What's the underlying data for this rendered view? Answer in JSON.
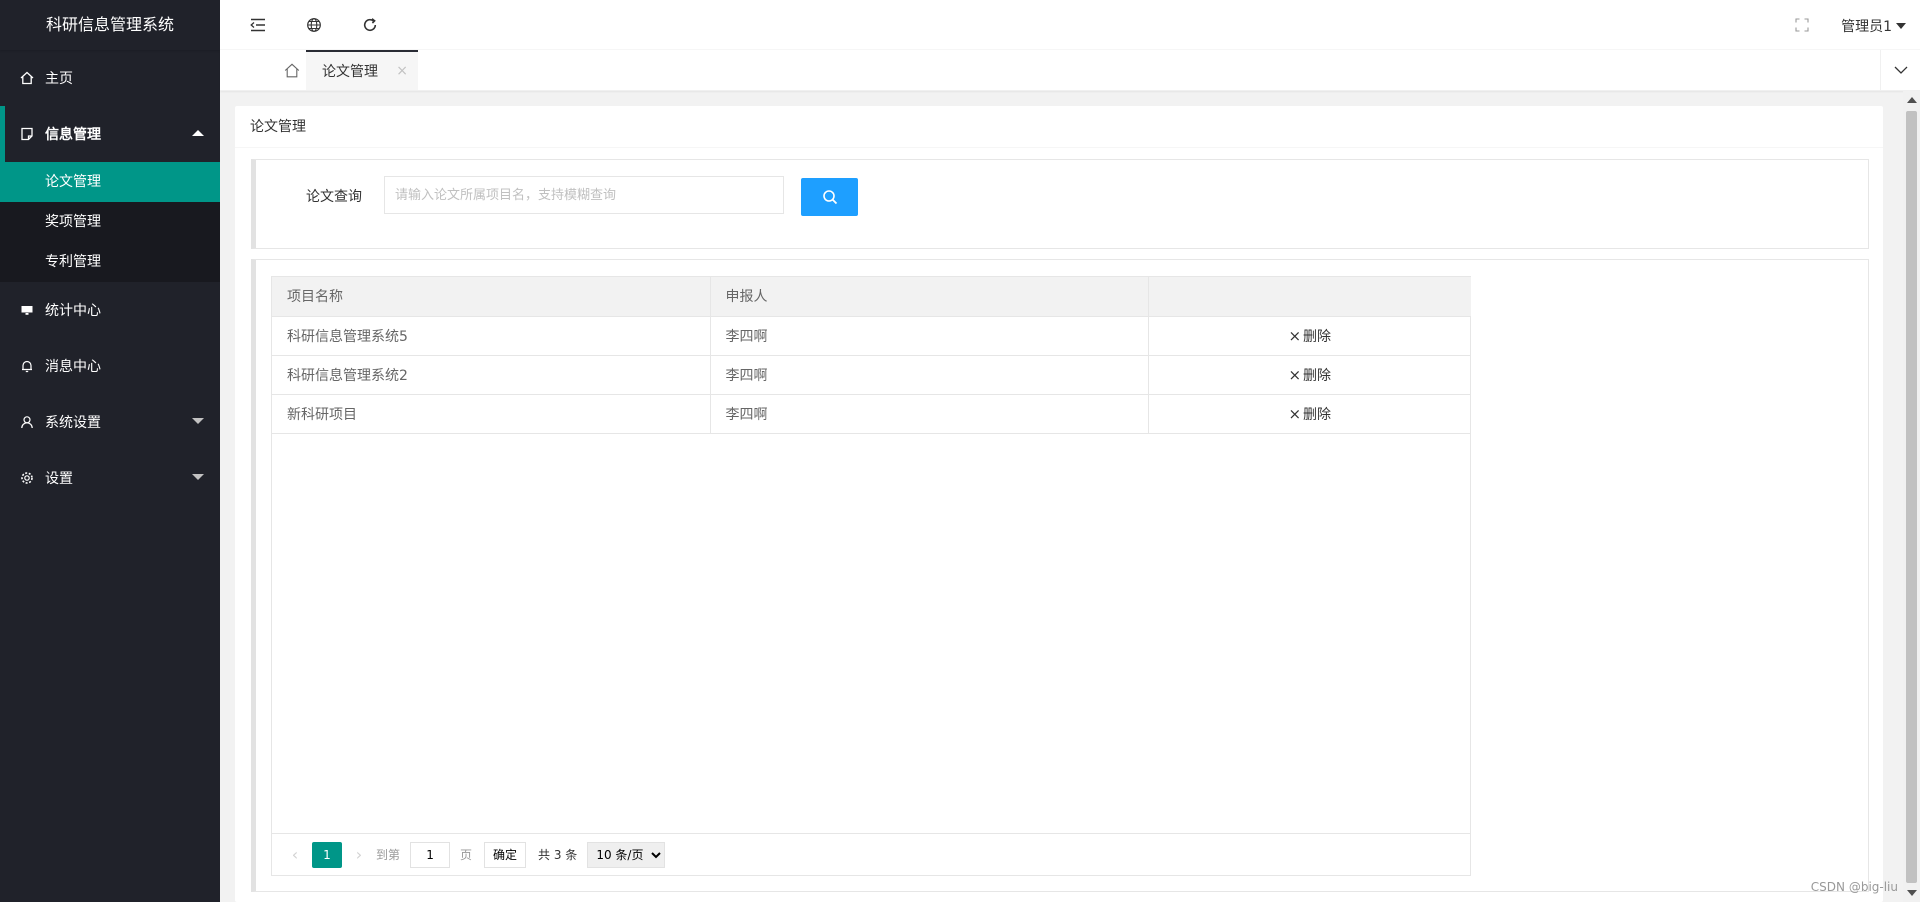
{
  "app": {
    "title": "科研信息管理系统"
  },
  "sidebar": {
    "items": [
      {
        "label": "主页",
        "icon": "home-icon"
      },
      {
        "label": "信息管理",
        "icon": "note-icon",
        "open": true,
        "children": [
          {
            "label": "论文管理",
            "active": true
          },
          {
            "label": "奖项管理"
          },
          {
            "label": "专利管理"
          }
        ]
      },
      {
        "label": "统计中心",
        "icon": "monitor-icon"
      },
      {
        "label": "消息中心",
        "icon": "bell-icon"
      },
      {
        "label": "系统设置",
        "icon": "user-icon"
      },
      {
        "label": "设置",
        "icon": "gear-icon"
      }
    ]
  },
  "header": {
    "buttons": [
      "menu-fold-icon",
      "globe-icon",
      "refresh-icon",
      "fullscreen-icon"
    ],
    "user": "管理员1"
  },
  "tabs": [
    {
      "label": "论文管理",
      "active": true
    }
  ],
  "card": {
    "title": "论文管理"
  },
  "search": {
    "label": "论文查询",
    "placeholder": "请输入论文所属项目名，支持模糊查询"
  },
  "table": {
    "columns": [
      "项目名称",
      "申报人",
      ""
    ],
    "rows": [
      {
        "name": "科研信息管理系统5",
        "applicant": "李四啊",
        "action": "删除"
      },
      {
        "name": "科研信息管理系统2",
        "applicant": "李四啊",
        "action": "删除"
      },
      {
        "name": "新科研项目",
        "applicant": "李四啊",
        "action": "删除"
      }
    ]
  },
  "pager": {
    "current": "1",
    "goto_label": "到第",
    "goto_value": "1",
    "page_suffix": "页",
    "confirm": "确定",
    "total": "共 3 条",
    "page_size": "10 条/页"
  },
  "watermark": "CSDN @big-liu",
  "colors": {
    "sidebar": "#20222a",
    "accent": "#009688",
    "search_button": "#1e9fff"
  }
}
